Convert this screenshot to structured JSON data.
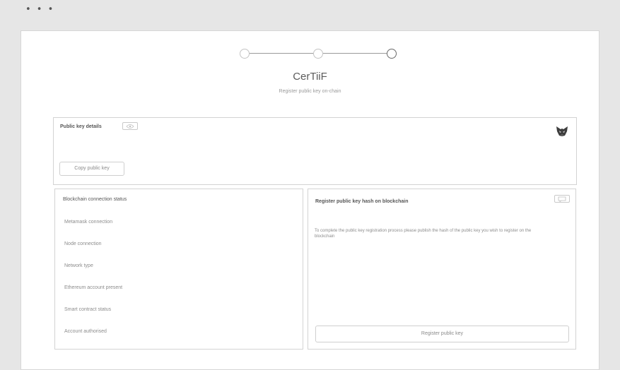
{
  "window": {
    "controls": "• • •"
  },
  "stepper": {
    "steps": [
      {
        "state": "done"
      },
      {
        "state": "done"
      },
      {
        "state": "current"
      }
    ]
  },
  "header": {
    "title": "CerTiiF",
    "subtitle": "Register public key on-chain"
  },
  "details": {
    "heading": "Public key details",
    "copy_button": "Copy public key",
    "wallet_icon": "metamask-fox-icon",
    "info_icon": "eye-icon"
  },
  "status": {
    "heading": "Blockchain connection status",
    "items": [
      "Metamask connection",
      "Node connection",
      "Network type",
      "Ethereum account present",
      "Smart contract status",
      "Account authorised"
    ]
  },
  "register": {
    "heading": "Register public key hash on blockchain",
    "description": "To complete the public key registration process please publish the hash of the public key you wish to register on the blockchain",
    "button": "Register public key",
    "info_icon": "chat-icon"
  },
  "colors": {
    "background": "#e6e6e6",
    "panel": "#ffffff",
    "border": "#d3d3d3",
    "text": "#555555",
    "muted": "#8c8c8c"
  }
}
